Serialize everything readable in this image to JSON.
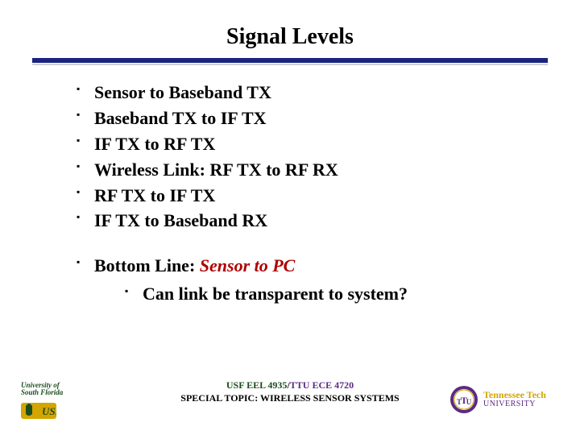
{
  "title": "Signal Levels",
  "bullets": [
    "Sensor to Baseband TX",
    "Baseband TX to IF TX",
    "IF TX to RF TX",
    "Wireless Link: RF TX to RF RX",
    "RF TX to IF TX",
    "IF TX to Baseband RX"
  ],
  "bottom": {
    "label": "Bottom Line:  ",
    "emph": "Sensor to PC",
    "sub": "Can link be transparent to system?"
  },
  "footer": {
    "line1_usf": "USF EEL 4935",
    "line1_sep": "/",
    "line1_ttu": "TTU ECE 4720",
    "line2": "SPECIAL TOPIC: WIRELESS SENSOR SYSTEMS"
  },
  "logo_usf": {
    "line1": "University of",
    "line2": "South Florida"
  },
  "logo_ttu": {
    "line1": "Tennessee Tech",
    "line2": "UNIVERSITY"
  }
}
